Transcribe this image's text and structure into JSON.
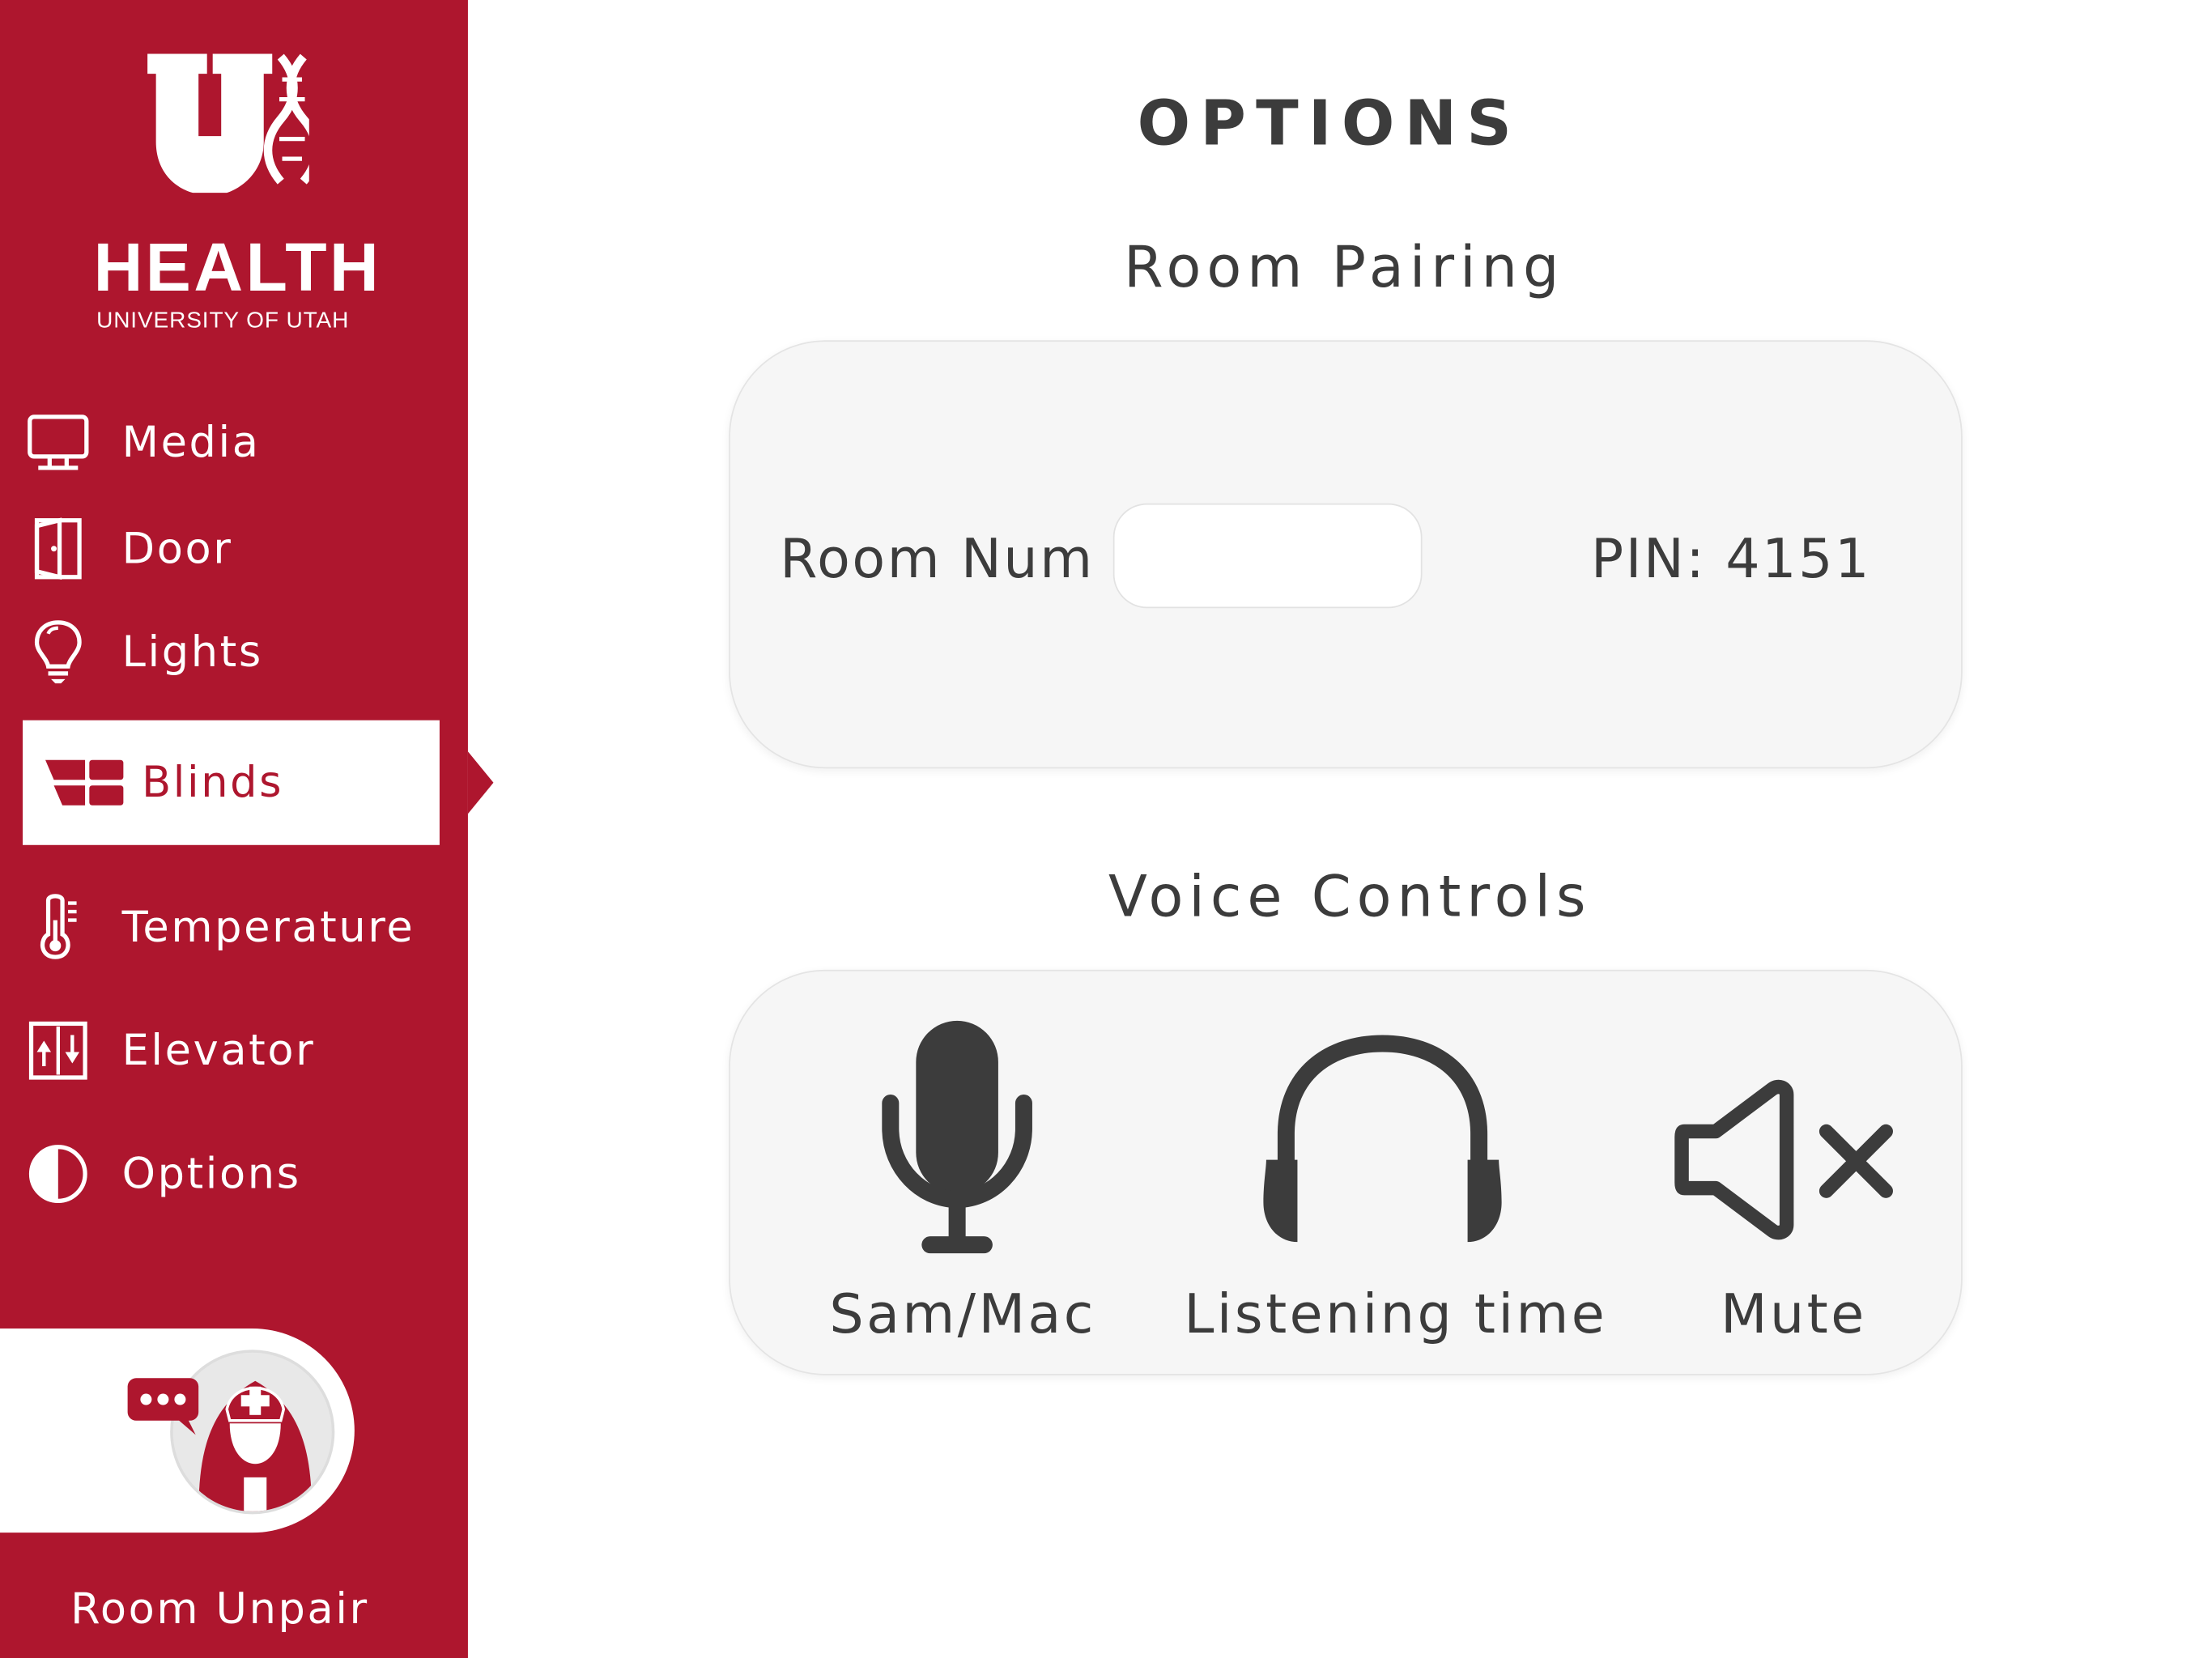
{
  "brand": {
    "name": "HEALTH",
    "subtitle": "UNIVERSITY OF UTAH",
    "color": "#ae162e"
  },
  "sidebar": {
    "items": [
      {
        "label": "Media",
        "icon": "monitor-icon"
      },
      {
        "label": "Door",
        "icon": "door-icon"
      },
      {
        "label": "Lights",
        "icon": "lightbulb-icon"
      },
      {
        "label": "Blinds",
        "icon": "blinds-icon",
        "active": true
      },
      {
        "label": "Temperature",
        "icon": "thermometer-icon"
      },
      {
        "label": "Elevator",
        "icon": "elevator-icon"
      },
      {
        "label": "Options",
        "icon": "contrast-icon"
      }
    ],
    "nurse_call_icon": "nurse-call-icon",
    "room_unpair_label": "Room Unpair"
  },
  "main": {
    "title": "OPTIONS",
    "room_pairing": {
      "heading": "Room Pairing",
      "room_num_label": "Room Num",
      "room_num_value": "",
      "pin_text": "PIN: 4151"
    },
    "voice_controls": {
      "heading": "Voice Controls",
      "buttons": [
        {
          "label": "Sam/Mac",
          "icon": "microphone-icon"
        },
        {
          "label": "Listening time",
          "icon": "headphones-icon"
        },
        {
          "label": "Mute",
          "icon": "speaker-mute-icon"
        }
      ]
    }
  },
  "colors": {
    "text": "#3c3c3c",
    "card": "#f6f6f6"
  }
}
